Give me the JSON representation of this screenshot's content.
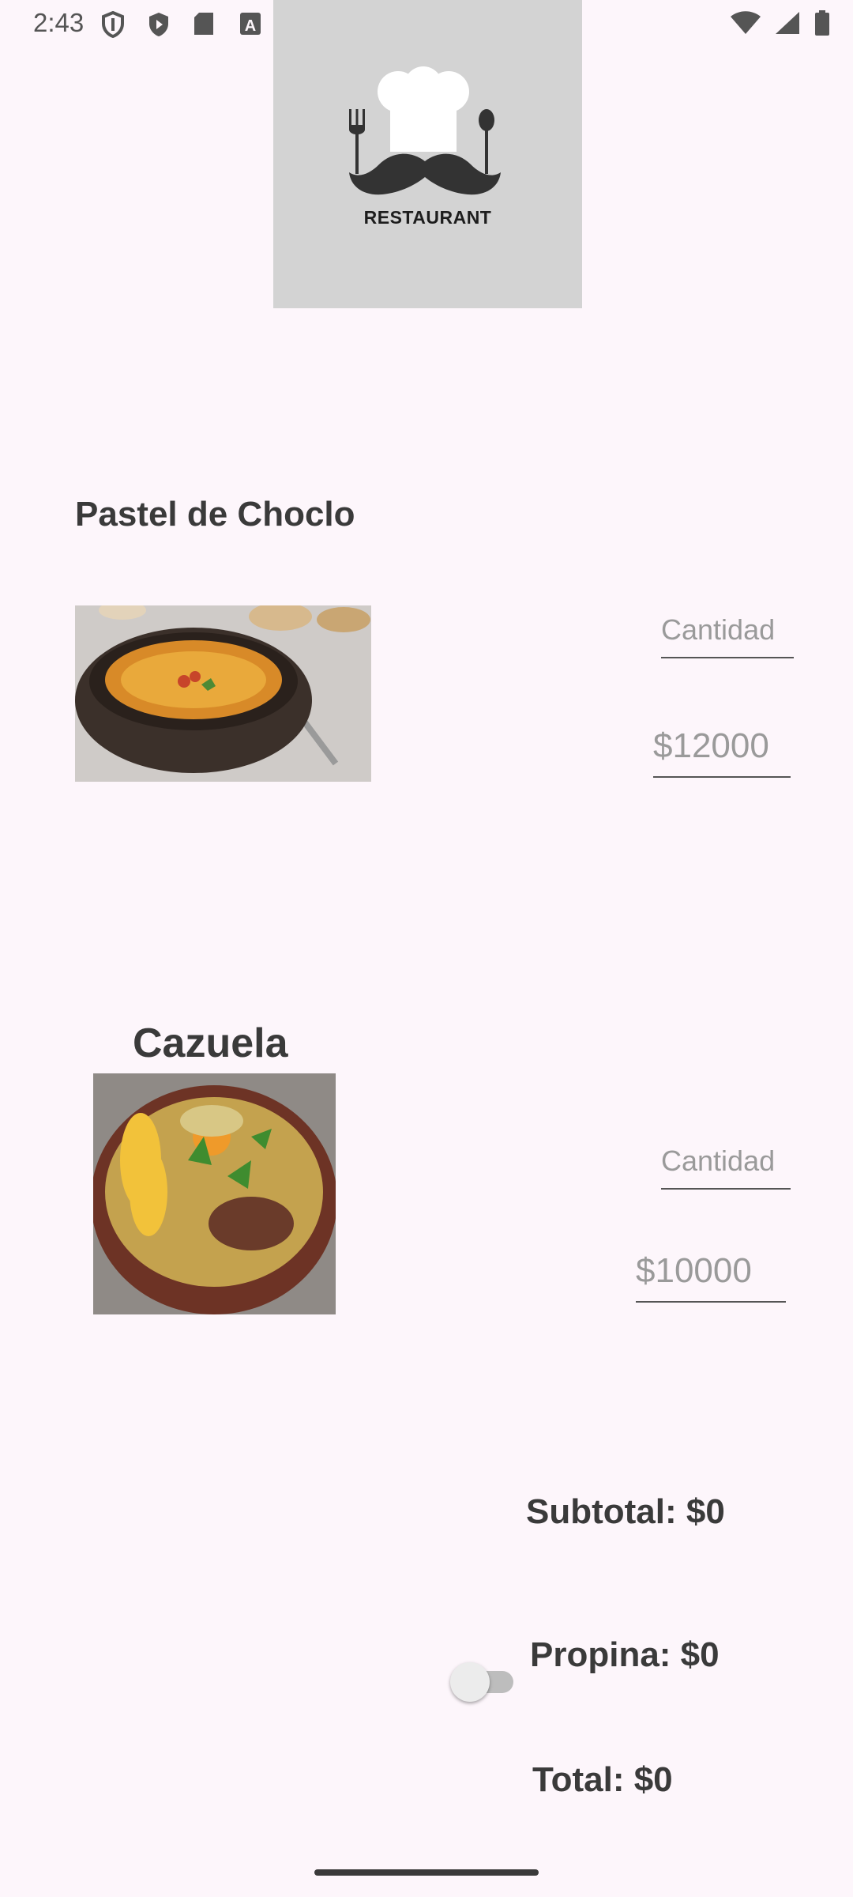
{
  "status_bar": {
    "time": "2:43",
    "icons": [
      "shield-icon",
      "play-protect-icon",
      "sd-card-icon",
      "font-a-icon",
      "dot-icon",
      "wifi-icon",
      "signal-icon",
      "battery-icon"
    ]
  },
  "logo": {
    "text": "RESTAURANT",
    "icons": [
      "chef-hat-icon",
      "mustache-icon",
      "fork-icon",
      "spoon-icon"
    ]
  },
  "dishes": [
    {
      "title": "Pastel de Choclo",
      "quantity_placeholder": "Cantidad",
      "price_placeholder": "$12000"
    },
    {
      "title": "Cazuela",
      "quantity_placeholder": "Cantidad",
      "price_placeholder": "$10000"
    }
  ],
  "totals": {
    "subtotal": "Subtotal: $0",
    "propina": "Propina: $0",
    "total": "Total: $0"
  },
  "tip_switch": {
    "on": false
  },
  "colors": {
    "background": "#fdf6fb",
    "logo_bg": "#d3d3d3",
    "text": "#3a3a3a",
    "placeholder": "#9a9a9a"
  }
}
